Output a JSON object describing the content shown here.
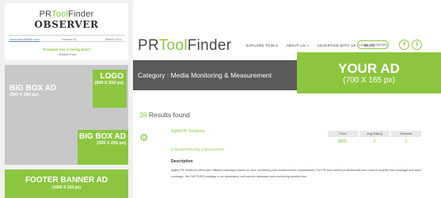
{
  "newsletter": {
    "logo_pre": "PR",
    "logo_acc": "Tool",
    "logo_post": "Finder",
    "title": "OBSERVER",
    "url": "www.prtoolfinder.com",
    "volume": "Volume 61",
    "date": "March 2022",
    "quote": "\"Freedom lies in being bold.\"",
    "author": "- Robert Frost",
    "ads": {
      "logo_title": "LOGO",
      "logo_size": "(200 X 200 px)",
      "bigbox1_title": "BIG BOX AD",
      "bigbox1_size": "(300 X 250 px)",
      "bigbox2_title": "BIG BOX AD",
      "bigbox2_size": "(300 X 250 px)",
      "footer_title": "FOOTER BANNER AD",
      "footer_size": "(1000 X 310 px)"
    }
  },
  "site": {
    "brand_pre": "PR",
    "brand_acc": "Tool",
    "brand_post": "Finder",
    "nav": [
      "EXPLORE TOOLS",
      "ABOUT US ˅",
      "ADVERTISE WITH US",
      "BLOG"
    ],
    "login": "LOGIN / REGISTER",
    "social_fb": "f",
    "social_tw": "t",
    "category": "Category : Media Monitoring & Measurement",
    "yourad_title": "YOUR AD",
    "yourad_size": "(700 X 165 px)",
    "results_num": "28",
    "results_text": " Results found",
    "company": "AgilityPR Solutions",
    "company_sub": "In Media Monitoring & Measurement",
    "table_headers": [
      "Price",
      "Avg Rating",
      "Reviews"
    ],
    "table_values": [
      "$950.",
      "0",
      "0"
    ],
    "desc_heading": "Description",
    "desc_text": "Agility PR Solutions offers two different packages based on your monitoring and measurement requirements. For PR and comms professionals who need to amplify their message and track coverage, the  CAPTURE  package is an  automated, self-service database and monitoring solution tha..."
  },
  "colors": {
    "accent": "#8cc63f",
    "dark_bar": "#5a5a5a",
    "ad_gray": "#c8c8c8"
  }
}
